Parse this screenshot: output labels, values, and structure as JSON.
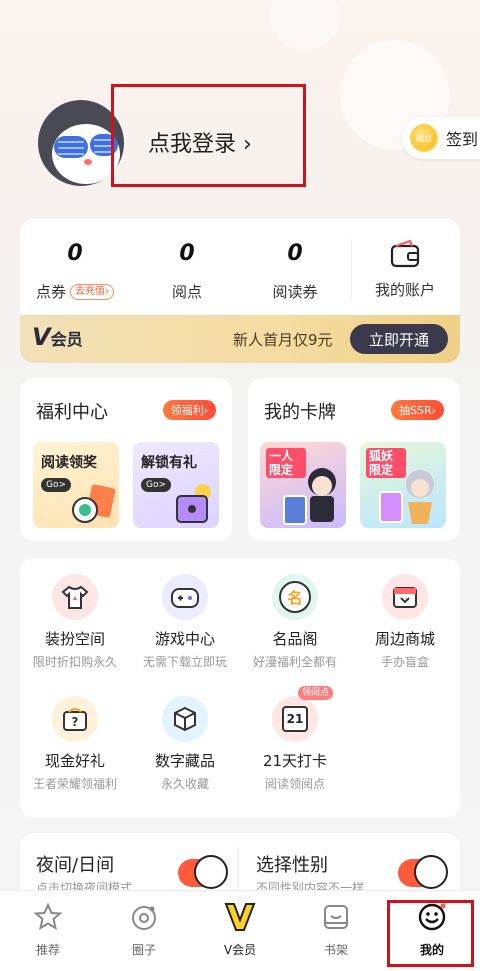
{
  "header": {
    "login_text": "点我登录 ›",
    "signin_label": "签到",
    "coin_text": "阅点"
  },
  "stats": [
    {
      "value": "0",
      "label": "点券",
      "badge": "去充值›"
    },
    {
      "value": "0",
      "label": "阅点"
    },
    {
      "value": "0",
      "label": "阅读券"
    }
  ],
  "account": {
    "label": "我的账户"
  },
  "vip": {
    "logo": "V",
    "logo_text": "会员",
    "promo": "新人首月仅9元",
    "button": "立即开通"
  },
  "welfare": {
    "title": "福利中心",
    "pill": "领福利›",
    "items": [
      {
        "text": "阅读领奖",
        "go": "Go>"
      },
      {
        "text": "解锁有礼",
        "go": "Go>"
      }
    ]
  },
  "cards": {
    "title": "我的卡牌",
    "pill": "抽SSR›",
    "items": [
      {
        "tag": "一人限定"
      },
      {
        "tag": "狐妖限定"
      }
    ]
  },
  "services": [
    {
      "name": "装扮空间",
      "sub": "限时折扣购永久",
      "icon": "tshirt-icon",
      "color": "#ffe6e6"
    },
    {
      "name": "游戏中心",
      "sub": "无需下载立即玩",
      "icon": "gamepad-icon",
      "color": "#ecebff"
    },
    {
      "name": "名品阁",
      "sub": "好漫福利全都有",
      "icon": "brand-icon",
      "color": "#e2f6f0",
      "glyph": "名"
    },
    {
      "name": "周边商城",
      "sub": "手办盲盒",
      "icon": "shop-icon",
      "color": "#ffe6e6"
    },
    {
      "name": "现金好礼",
      "sub": "王者荣耀领福利",
      "icon": "gift-box-icon",
      "color": "#fff1dc"
    },
    {
      "name": "数字藏品",
      "sub": "永久收藏",
      "icon": "cube-icon",
      "color": "#e3f3ff"
    },
    {
      "name": "21天打卡",
      "sub": "阅读领阅点",
      "icon": "calendar-icon",
      "color": "#ffe6e6",
      "glyph": "21",
      "badge": "领阅点"
    }
  ],
  "settings": [
    {
      "title": "夜间/日间",
      "sub": "点击切换夜间模式"
    },
    {
      "title": "选择性别",
      "sub": "不同性别内容不一样"
    }
  ],
  "nav": [
    {
      "label": "推荐",
      "icon": "star-icon"
    },
    {
      "label": "圈子",
      "icon": "circle-icon"
    },
    {
      "label": "V会员",
      "icon": "vip-icon"
    },
    {
      "label": "书架",
      "icon": "bookshelf-icon"
    },
    {
      "label": "我的",
      "icon": "profile-icon",
      "active": true
    }
  ],
  "colors": {
    "accent": "#ff5a3c",
    "highlight_box": "#d0121b",
    "vip_button": "#3a3a4c"
  }
}
